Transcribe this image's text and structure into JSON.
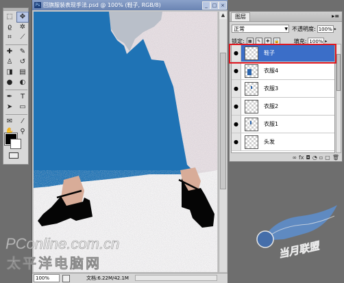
{
  "document": {
    "title": "回旗服装表现手法.psd @ 100% (鞋子, RGB/8)",
    "badge": "Ps",
    "zoom": "100%",
    "doc_size": "文档:6.22M/42.1M"
  },
  "window_buttons": {
    "minimize": "_",
    "maximize": "□",
    "close": "×"
  },
  "tools": [
    {
      "name": "marquee-tool",
      "glyph": "⬚"
    },
    {
      "name": "move-tool",
      "glyph": "✥"
    },
    {
      "name": "lasso-tool",
      "glyph": "ϱ"
    },
    {
      "name": "magic-wand-tool",
      "glyph": "✲"
    },
    {
      "name": "crop-tool",
      "glyph": "⌗"
    },
    {
      "name": "slice-tool",
      "glyph": "⟋"
    },
    {
      "name": "healing-tool",
      "glyph": "✚"
    },
    {
      "name": "brush-tool",
      "glyph": "✎"
    },
    {
      "name": "stamp-tool",
      "glyph": "♙"
    },
    {
      "name": "history-brush-tool",
      "glyph": "↺"
    },
    {
      "name": "eraser-tool",
      "glyph": "◨"
    },
    {
      "name": "gradient-tool",
      "glyph": "▤"
    },
    {
      "name": "blur-tool",
      "glyph": "●"
    },
    {
      "name": "dodge-tool",
      "glyph": "◐"
    },
    {
      "name": "pen-tool",
      "glyph": "✒"
    },
    {
      "name": "type-tool",
      "glyph": "T"
    },
    {
      "name": "path-select-tool",
      "glyph": "➤"
    },
    {
      "name": "shape-tool",
      "glyph": "▭"
    },
    {
      "name": "notes-tool",
      "glyph": "✉"
    },
    {
      "name": "eyedropper-tool",
      "glyph": "⁄"
    },
    {
      "name": "hand-tool",
      "glyph": "✋"
    },
    {
      "name": "zoom-tool",
      "glyph": "⚲"
    }
  ],
  "layers_panel": {
    "tab": "图层",
    "menu": "▸≡",
    "blend_mode": "正常",
    "opacity_label": "不透明度:",
    "opacity": "100%",
    "lock_label": "锁定:",
    "fill_label": "填充:",
    "fill": "100%",
    "layers": [
      {
        "name": "鞋子",
        "selected": true
      },
      {
        "name": "衣服4",
        "selected": false
      },
      {
        "name": "衣服3",
        "selected": false
      },
      {
        "name": "衣服2",
        "selected": false
      },
      {
        "name": "衣服1",
        "selected": false
      },
      {
        "name": "头发",
        "selected": false
      }
    ],
    "bottom_buttons": [
      "∞",
      "fx",
      "◘",
      "◔",
      "▫",
      "▢",
      "🗑"
    ]
  },
  "watermark": {
    "site": "PConline.com.cn",
    "cn": "太平洋电脑网",
    "badge": "当月联盟"
  },
  "colors": {
    "canvas_blue": "#1f73b5",
    "selection_outline": "#e0151e",
    "selected_row": "#3b6ec8"
  }
}
